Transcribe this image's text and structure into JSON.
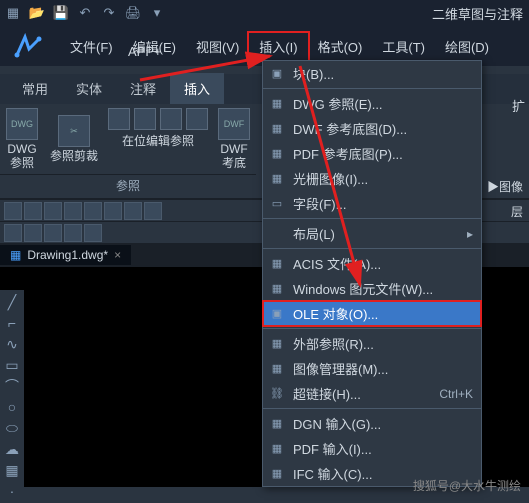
{
  "workspace_label": "二维草图与注释",
  "menubar": {
    "file": "文件(F)",
    "edit": "编辑(E)",
    "view": "视图(V)",
    "insert": "插入(I)",
    "format": "格式(O)",
    "tools": "工具(T)",
    "draw": "绘图(D)"
  },
  "app_plus": "APP+",
  "tabs": {
    "common": "常用",
    "solid": "实体",
    "annotate": "注释",
    "insert": "插入"
  },
  "ext_tab": "扩",
  "ribbon": {
    "dwg_ref": "DWG\n参照",
    "clip_ref": "参照剪裁",
    "edit_inplace": "在位编辑参照",
    "dwf_ref": "DWF\n考底",
    "panel": "参照",
    "image_panel": "▶图像",
    "layer_panel": "层"
  },
  "doc_tab": "Drawing1.dwg*",
  "dropdown": {
    "block": "块(B)...",
    "dwg_ref": "DWG 参照(E)...",
    "dwf_ref": "DWF 参考底图(D)...",
    "pdf_ref": "PDF 参考底图(P)...",
    "raster": "光栅图像(I)...",
    "field": "字段(F)...",
    "layout": "布局(L)",
    "acis": "ACIS 文件(A)...",
    "wmf": "Windows 图元文件(W)...",
    "ole": "OLE 对象(O)...",
    "xref": "外部参照(R)...",
    "img_mgr": "图像管理器(M)...",
    "hyperlink": "超链接(H)...",
    "hyperlink_sc": "Ctrl+K",
    "dgn": "DGN 输入(G)...",
    "pdf_in": "PDF 输入(I)...",
    "ifc": "IFC 输入(C)..."
  },
  "watermark": "搜狐号@大水牛测绘"
}
